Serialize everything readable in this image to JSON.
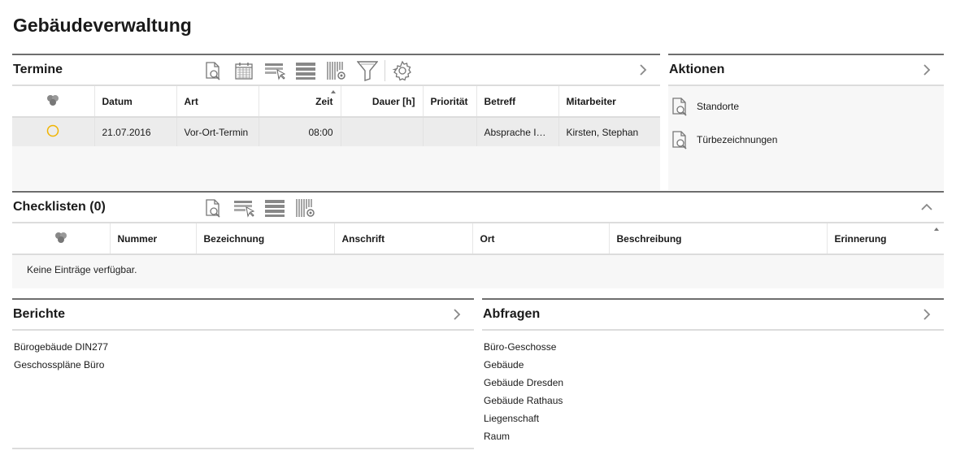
{
  "page": {
    "title": "Gebäudeverwaltung"
  },
  "termine": {
    "title": "Termine",
    "columns": [
      "Datum",
      "Art",
      "Zeit",
      "Dauer [h]",
      "Priorität",
      "Betreff",
      "Mitarbeiter"
    ],
    "rows": [
      {
        "datum": "21.07.2016",
        "art": "Vor-Ort-Termin",
        "zeit": "08:00",
        "dauer": "",
        "prioritaet": "",
        "betreff": "Absprache In…",
        "mitarbeiter": "Kirsten, Stephan"
      }
    ]
  },
  "aktionen": {
    "title": "Aktionen",
    "items": [
      {
        "label": "Standorte",
        "icon": "document-search-icon"
      },
      {
        "label": "Türbezeichnungen",
        "icon": "document-search-icon"
      }
    ]
  },
  "checklisten": {
    "title": "Checklisten (0)",
    "columns": [
      "Nummer",
      "Bezeichnung",
      "Anschrift",
      "Ort",
      "Beschreibung",
      "Erinnerung"
    ],
    "empty_text": "Keine Einträge verfügbar."
  },
  "berichte": {
    "title": "Berichte",
    "items": [
      "Bürogebäude DIN277",
      "Geschosspläne Büro"
    ]
  },
  "abfragen": {
    "title": "Abfragen",
    "items": [
      "Büro-Geschosse",
      "Gebäude",
      "Gebäude Dresden",
      "Gebäude Rathaus",
      "Liegenschaft",
      "Raum"
    ]
  },
  "colors": {
    "accent": "#f0b400",
    "border": "#6e6e6e",
    "row_bg": "#ececec",
    "panel_bg": "#f7f7f7"
  }
}
